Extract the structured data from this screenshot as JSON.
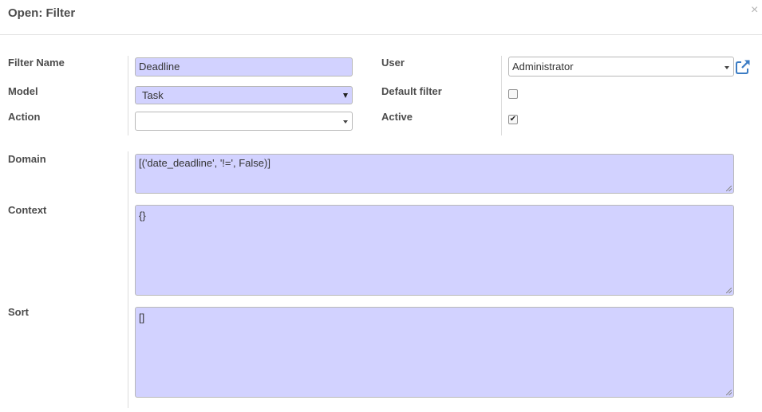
{
  "dialog": {
    "title": "Open: Filter",
    "close_symbol": "×"
  },
  "form": {
    "filter_name": {
      "label": "Filter Name",
      "value": "Deadline"
    },
    "model": {
      "label": "Model",
      "value": "Task"
    },
    "action": {
      "label": "Action",
      "value": ""
    },
    "user": {
      "label": "User",
      "value": "Administrator",
      "open_icon": "external-link-icon"
    },
    "default_filter": {
      "label": "Default filter",
      "checked": false
    },
    "active": {
      "label": "Active",
      "checked": true,
      "check_symbol": "✔"
    },
    "domain": {
      "label": "Domain",
      "value": "[('date_deadline', '!=', False)]"
    },
    "context": {
      "label": "Context",
      "value": "{}"
    },
    "sort": {
      "label": "Sort",
      "value": "[]"
    }
  },
  "colors": {
    "required_field_bg": "#d2d2ff",
    "link_icon": "#3b7cc4"
  }
}
